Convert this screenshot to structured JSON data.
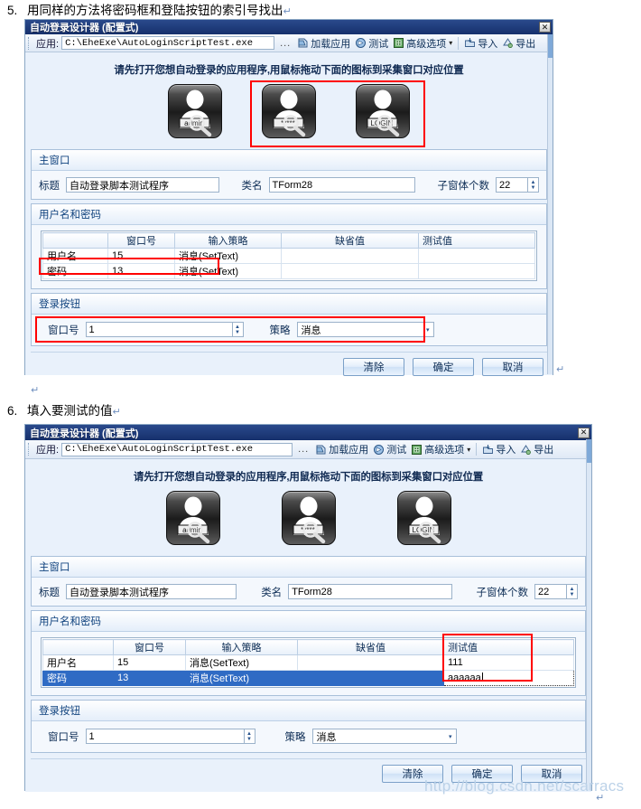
{
  "document": {
    "steps": [
      {
        "num": "5.",
        "text": "用同样的方法将密码框和登陆按钮的索引号找出",
        "mark": "↵"
      },
      {
        "num": "6.",
        "text": "填入要测试的值",
        "mark": "↵"
      }
    ],
    "stray_marks": [
      "↵",
      "↵",
      "↵"
    ]
  },
  "watermark": "http://blog.csdn.net/scarracs",
  "window": {
    "title": "自动登录设计器 (配置式)",
    "close_label": "✕",
    "toolbar": {
      "app_label": "应用:",
      "path_value": "C:\\EheExe\\AutoLoginScriptTest.exe",
      "browse_label": "...",
      "items": [
        {
          "label": "加载应用",
          "icon": "load-app-icon"
        },
        {
          "label": "测试",
          "icon": "test-icon"
        },
        {
          "label": "高级选项",
          "icon": "advanced-options-icon",
          "caret": "▾"
        },
        {
          "label": "导入",
          "icon": "import-icon"
        },
        {
          "label": "导出",
          "icon": "export-icon"
        }
      ]
    },
    "hint": "请先打开您想自动登录的应用程序,用鼠标拖动下面的图标到采集窗口对应位置",
    "drag_icons": [
      {
        "name": "username-drag-icon",
        "caption": "admin"
      },
      {
        "name": "password-drag-icon",
        "caption": "*****"
      },
      {
        "name": "login-drag-icon",
        "caption": "LOGIN"
      }
    ],
    "main_window_group": {
      "title": "主窗口",
      "caption_label": "标题",
      "caption_value": "自动登录脚本测试程序",
      "classname_label": "类名",
      "classname_value": "TForm28",
      "childcount_label": "子窗体个数",
      "childcount_value": "22"
    },
    "credentials_group": {
      "title": "用户名和密码",
      "columns": [
        "",
        "窗口号",
        "输入策略",
        "缺省值",
        "测试值"
      ],
      "rows_a": [
        {
          "name": "用户名",
          "handle": "15",
          "strategy": "消息(SetText)",
          "default": "",
          "test": ""
        },
        {
          "name": "密码",
          "handle": "13",
          "strategy": "消息(SetText)",
          "default": "",
          "test": ""
        }
      ],
      "rows_b": [
        {
          "name": "用户名",
          "handle": "15",
          "strategy": "消息(SetText)",
          "default": "",
          "test": "111"
        },
        {
          "name": "密码",
          "handle": "13",
          "strategy": "消息(SetText)",
          "default": "",
          "test": "aaaaaa"
        }
      ]
    },
    "login_button_group": {
      "title": "登录按钮",
      "handle_label": "窗口号",
      "handle_value": "1",
      "strategy_label": "策略",
      "strategy_value": "消息",
      "strategy_caret": "▾"
    },
    "footer_buttons": [
      {
        "label": "清除",
        "name": "clear-button"
      },
      {
        "label": "确定",
        "name": "ok-button"
      },
      {
        "label": "取消",
        "name": "cancel-button"
      }
    ]
  },
  "colors": {
    "titlebar": "#1f3a78",
    "highlight_box": "#ff0000",
    "selection": "#2f6bc4",
    "window_bg": "#e9f1fb",
    "watermark": "#bcd2e8"
  }
}
